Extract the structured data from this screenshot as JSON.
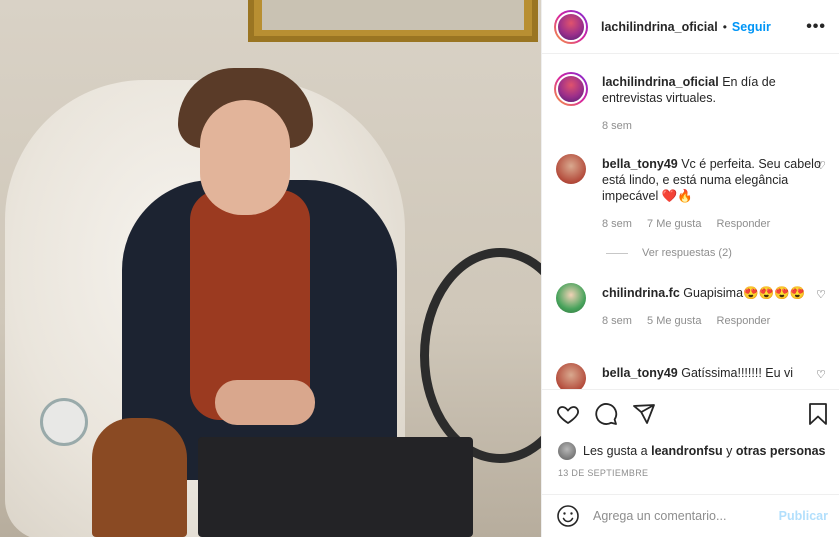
{
  "header": {
    "username": "lachilindrina_oficial",
    "separator": "•",
    "follow_label": "Seguir",
    "more_icon": "ellipsis-icon"
  },
  "caption": {
    "username": "lachilindrina_oficial",
    "text": "En día de entrevistas virtuales.",
    "time": "8 sem"
  },
  "comments": [
    {
      "username": "bella_tony49",
      "text": "Vc é perfeita. Seu cabelo está lindo, e está numa elegância impecável ❤️🔥",
      "time": "8 sem",
      "likes": "7 Me gusta",
      "reply": "Responder",
      "view_replies": "Ver respuestas (2)"
    },
    {
      "username": "chilindrina.fc",
      "text": "Guapisima😍😍😍😍",
      "time": "8 sem",
      "likes": "5 Me gusta",
      "reply": "Responder"
    },
    {
      "username": "bella_tony49",
      "text": "Gatíssima!!!!!!! Eu vi"
    }
  ],
  "likes": {
    "prefix": "Les gusta a",
    "user": "leandronfsu",
    "conj": "y",
    "others": "otras personas"
  },
  "date": "13 DE SEPTIEMBRE",
  "add_comment": {
    "placeholder": "Agrega un comentario...",
    "post_label": "Publicar"
  }
}
